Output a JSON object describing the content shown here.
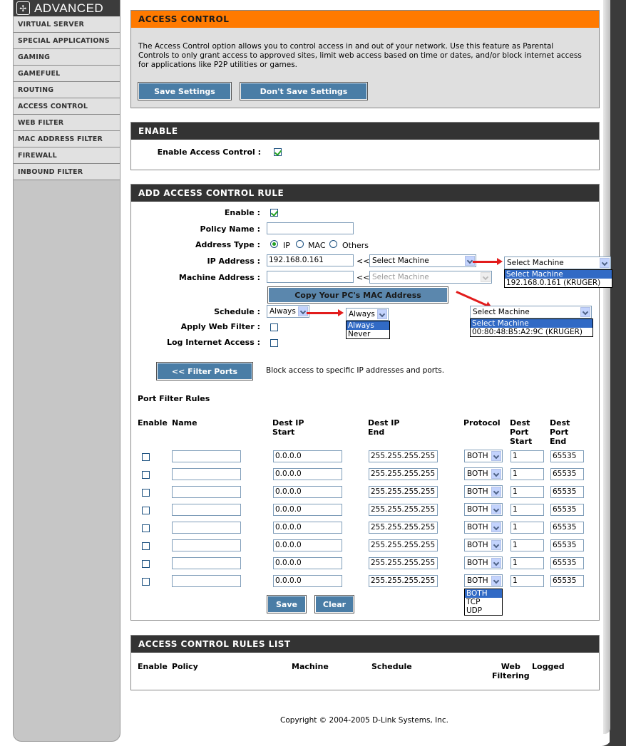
{
  "sidebar": {
    "title": "ADVANCED",
    "items": [
      {
        "label": "VIRTUAL SERVER"
      },
      {
        "label": "SPECIAL APPLICATIONS"
      },
      {
        "label": "GAMING"
      },
      {
        "label": "GAMEFUEL"
      },
      {
        "label": "ROUTING"
      },
      {
        "label": "ACCESS CONTROL"
      },
      {
        "label": "WEB FILTER"
      },
      {
        "label": "MAC ADDRESS FILTER"
      },
      {
        "label": "FIREWALL"
      },
      {
        "label": "INBOUND FILTER"
      }
    ]
  },
  "access_control": {
    "title": "ACCESS CONTROL",
    "description": "The Access Control option allows you to control access in and out of your network. Use this feature as Parental Controls to only grant access to approved sites, limit web access based on time or dates, and/or block internet access for applications like P2P utilities or games.",
    "save_label": "Save Settings",
    "dont_save_label": "Don't Save Settings"
  },
  "enable": {
    "title": "ENABLE",
    "label": "Enable Access Control :",
    "checked": true
  },
  "add_rule": {
    "title": "ADD ACCESS CONTROL RULE",
    "enable_label": "Enable :",
    "policy_label": "Policy Name :",
    "policy_value": "",
    "address_type_label": "Address Type :",
    "address_options": [
      "IP",
      "MAC",
      "Others"
    ],
    "address_selected": "IP",
    "ip_label": "IP Address :",
    "ip_value": "192.168.0.161",
    "ip_select": "Select Machine",
    "mac_label": "Machine Address :",
    "mac_value": "",
    "mac_select": "Select Machine",
    "copy_mac_label": "Copy Your PC's MAC Address",
    "schedule_label": "Schedule :",
    "schedule_value": "Always",
    "web_filter_label": "Apply Web Filter :",
    "log_label": "Log Internet Access :",
    "filter_ports_label": "<< Filter Ports",
    "filter_ports_desc": "Block access to specific IP addresses and ports.",
    "back_arrows": "<<",
    "ip_dropdown": {
      "selected": "Select Machine",
      "options": [
        "Select Machine",
        "192.168.0.161 (KRUGER)"
      ]
    },
    "mac_dropdown": {
      "selected": "Select Machine",
      "options": [
        "Select Machine",
        "00:80:48:B5:A2:9C (KRUGER)"
      ]
    },
    "schedule_dropdown": {
      "selected": "Always",
      "options": [
        "Always",
        "Never"
      ]
    }
  },
  "port_filter": {
    "title": "Port Filter Rules",
    "headers": {
      "enable": "Enable",
      "name": "Name",
      "dest_ip_start_1": "Dest IP",
      "dest_ip_start_2": "Start",
      "dest_ip_end_1": "Dest IP",
      "dest_ip_end_2": "End",
      "protocol": "Protocol",
      "port_start_1": "Dest",
      "port_start_2": "Port",
      "port_start_3": "Start",
      "port_end_1": "Dest",
      "port_end_2": "Port",
      "port_end_3": "End"
    },
    "rows": [
      {
        "ip_start": "0.0.0.0",
        "ip_end": "255.255.255.255",
        "protocol": "BOTH",
        "port_start": "1",
        "port_end": "65535"
      },
      {
        "ip_start": "0.0.0.0",
        "ip_end": "255.255.255.255",
        "protocol": "BOTH",
        "port_start": "1",
        "port_end": "65535"
      },
      {
        "ip_start": "0.0.0.0",
        "ip_end": "255.255.255.255",
        "protocol": "BOTH",
        "port_start": "1",
        "port_end": "65535"
      },
      {
        "ip_start": "0.0.0.0",
        "ip_end": "255.255.255.255",
        "protocol": "BOTH",
        "port_start": "1",
        "port_end": "65535"
      },
      {
        "ip_start": "0.0.0.0",
        "ip_end": "255.255.255.255",
        "protocol": "BOTH",
        "port_start": "1",
        "port_end": "65535"
      },
      {
        "ip_start": "0.0.0.0",
        "ip_end": "255.255.255.255",
        "protocol": "BOTH",
        "port_start": "1",
        "port_end": "65535"
      },
      {
        "ip_start": "0.0.0.0",
        "ip_end": "255.255.255.255",
        "protocol": "BOTH",
        "port_start": "1",
        "port_end": "65535"
      },
      {
        "ip_start": "0.0.0.0",
        "ip_end": "255.255.255.255",
        "protocol": "BOTH",
        "port_start": "1",
        "port_end": "65535"
      }
    ],
    "protocol_options": [
      "BOTH",
      "TCP",
      "UDP"
    ],
    "save_label": "Save",
    "clear_label": "Clear"
  },
  "rules_list": {
    "title": "ACCESS CONTROL RULES LIST",
    "headers": {
      "enable": "Enable",
      "policy": "Policy",
      "machine": "Machine",
      "schedule": "Schedule",
      "web_1": "Web",
      "web_2": "Filtering",
      "logged": "Logged"
    }
  },
  "footer": {
    "copyright": "Copyright © 2004-2005 D-Link Systems, Inc."
  },
  "colors": {
    "header_orange": "#ff7a00",
    "header_dark": "#333333",
    "button_blue": "#4a7da6",
    "highlight": "#316ac5",
    "arrow_red": "#e21c1c"
  }
}
